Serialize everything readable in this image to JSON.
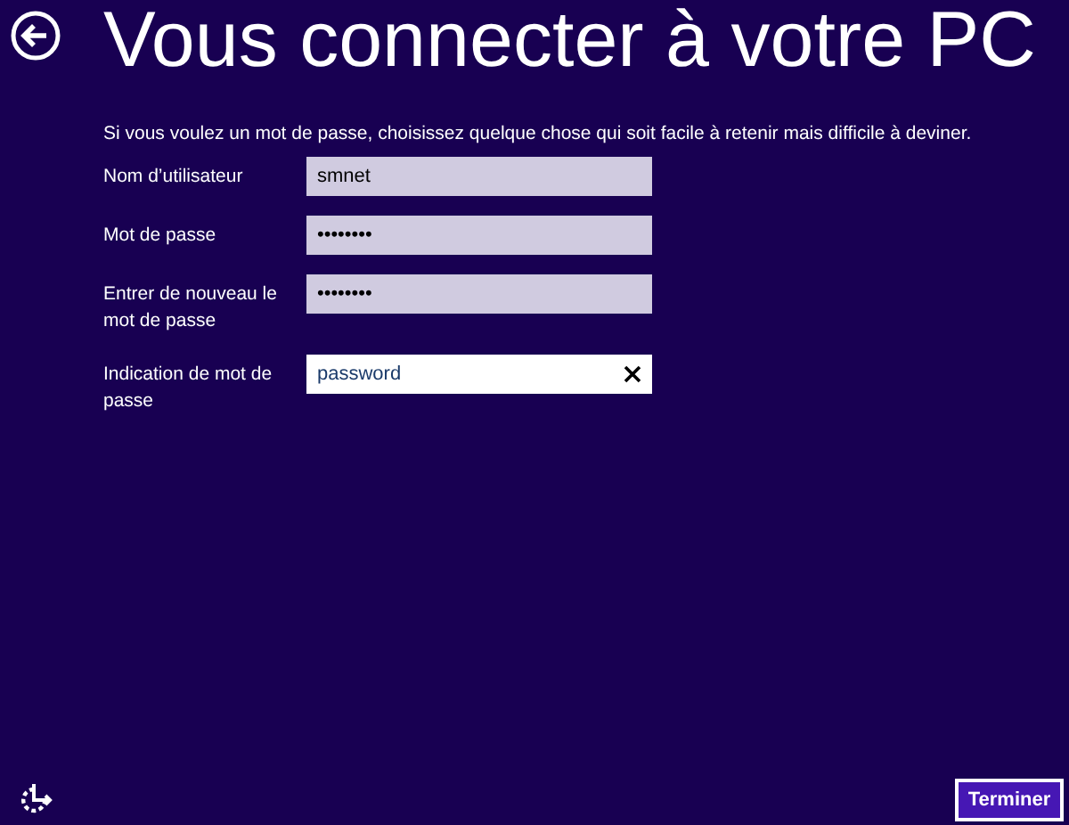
{
  "title": "Vous connecter à votre PC",
  "intro": "Si vous voulez un mot de passe, choisissez quelque chose qui soit facile à retenir mais difficile à deviner.",
  "fields": [
    {
      "label": "Nom d’utilisateur",
      "value": "smnet",
      "focused": false
    },
    {
      "label": "Mot de passe",
      "value": "••••••••",
      "focused": false
    },
    {
      "label": "Entrer de nouveau le mot de passe",
      "value": "••••••••",
      "focused": false
    },
    {
      "label": "Indication de mot de passe",
      "value": "password",
      "focused": true
    }
  ],
  "finish_button": "Terminer"
}
